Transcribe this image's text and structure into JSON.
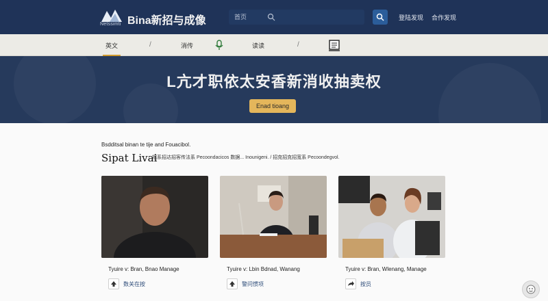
{
  "header": {
    "logo_sub": "Netssimti",
    "brand": "Bina新招与成像",
    "search_placeholder": "首页",
    "links": [
      "登陆发现",
      "合作发现"
    ]
  },
  "nav": {
    "items": [
      "英文",
      "消传",
      "读读"
    ],
    "separator": "/"
  },
  "hero": {
    "title": "L亢才职依太安香新消收抽卖权",
    "cta": "Enad tioang"
  },
  "section": {
    "intro": "Bsdditsal binan te tije and Fouacibol.",
    "title": "Sipat Livai",
    "description": "招系招达招客传法系 Pecoondacicos 数据... Inounigeni. / 招克招克招宽系 Pecoondegvol."
  },
  "cards": [
    {
      "name": "Tyuire v: Bran, Bnao Manage",
      "action_label": "数关在按"
    },
    {
      "name": "Tyuire v: Lbin Bdnad, Wanang",
      "action_label": "警问惯项"
    },
    {
      "name": "Tyuire v: Bran, Wlenang, Manage",
      "action_label": "按员"
    }
  ],
  "help": {
    "label": "?"
  },
  "colors": {
    "header_bg": "#1f3358",
    "accent": "#e4b65b",
    "nav_bg": "#ecebe6"
  }
}
